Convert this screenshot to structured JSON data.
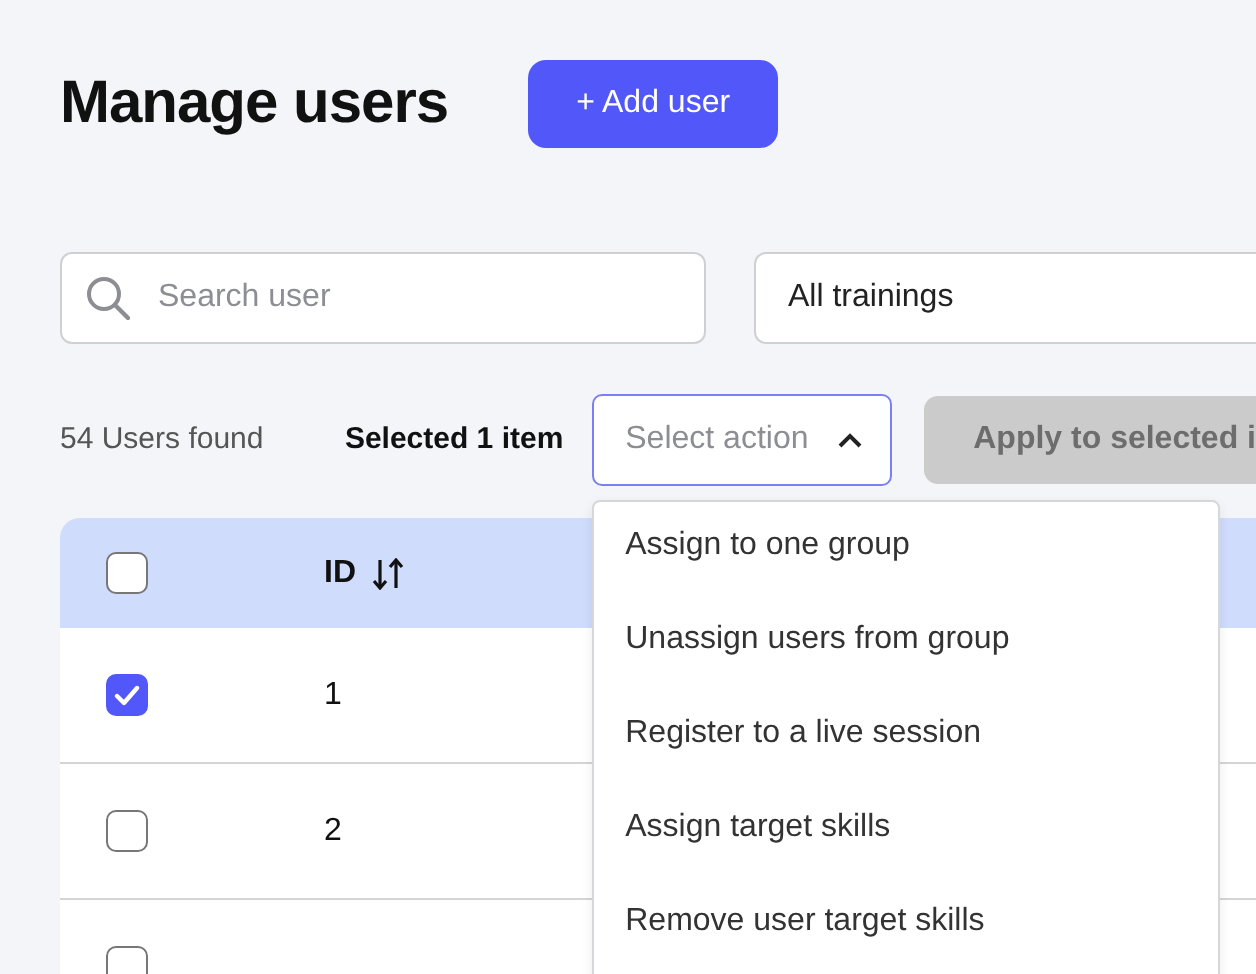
{
  "title": "Manage users",
  "add_button": "+ Add user",
  "search": {
    "placeholder": "Search user"
  },
  "training_filter": {
    "value": "All trainings"
  },
  "users_found": "54 Users found",
  "selection": "Selected 1 item",
  "action_select": {
    "placeholder": "Select action",
    "expanded": true,
    "options": [
      {
        "label": "Assign to one group"
      },
      {
        "label": "Unassign users from group"
      },
      {
        "label": "Register to a live session"
      },
      {
        "label": "Assign target skills"
      },
      {
        "label": "Remove user target skills"
      }
    ]
  },
  "apply_button": {
    "label": "Apply to selected i",
    "disabled": true
  },
  "table": {
    "header_checked": false,
    "columns": {
      "id": "ID"
    },
    "rows": [
      {
        "checked": true,
        "id": "1"
      },
      {
        "checked": false,
        "id": "2"
      },
      {
        "checked": false
      }
    ]
  }
}
